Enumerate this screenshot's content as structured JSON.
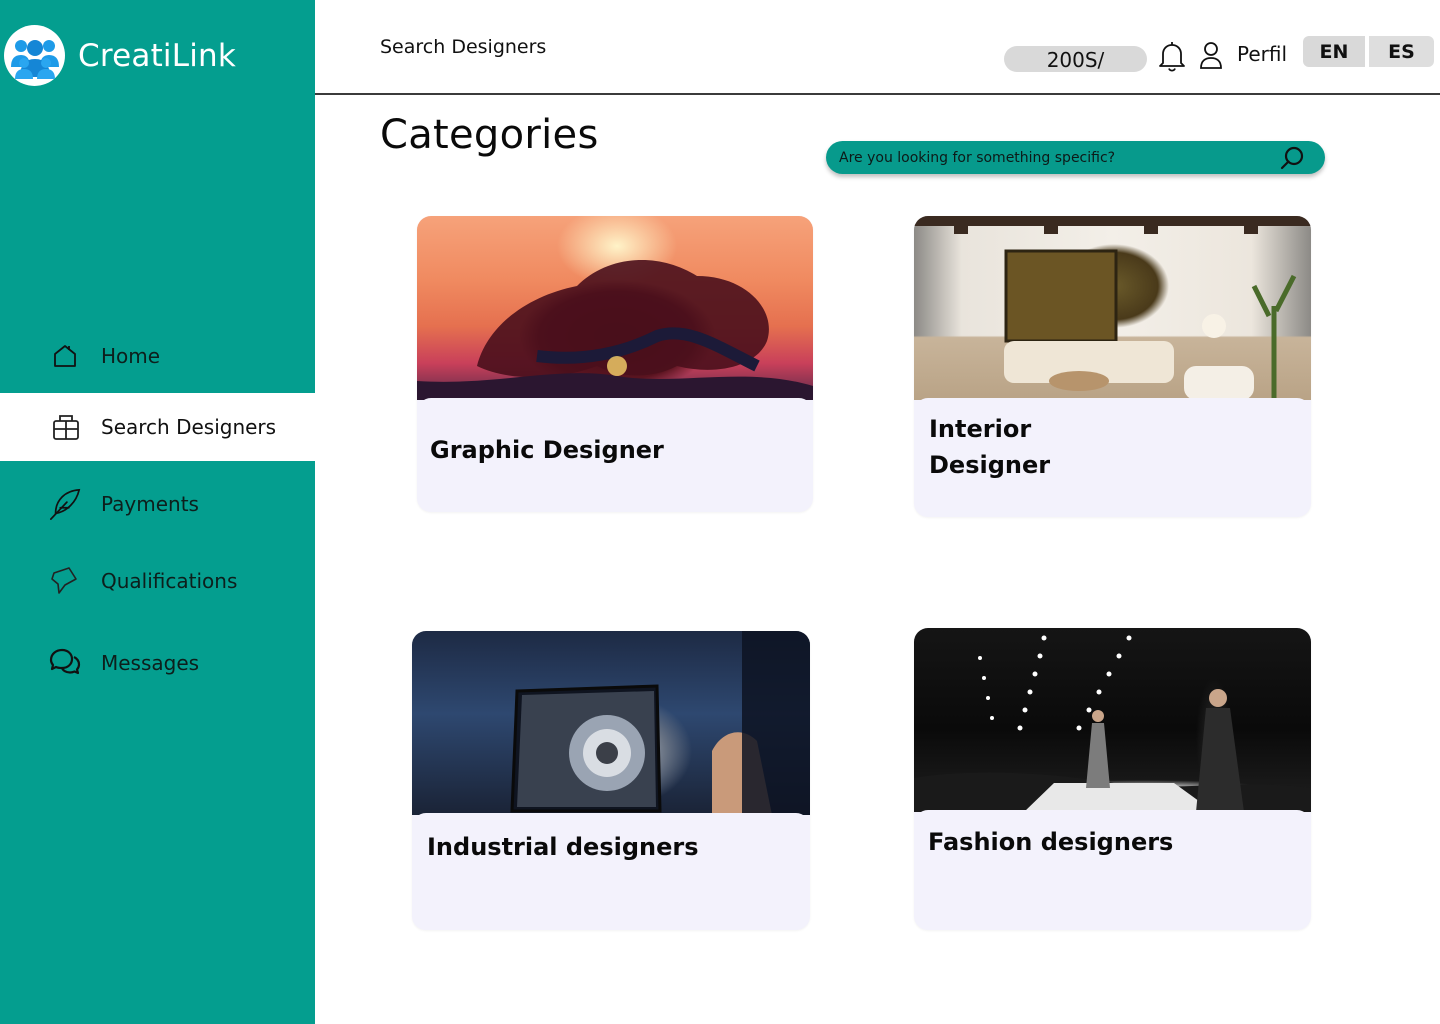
{
  "app": {
    "name": "CreatiLink"
  },
  "sidebar": {
    "items": [
      {
        "label": "Home",
        "icon": "home-icon",
        "active": false
      },
      {
        "label": "Search Designers",
        "icon": "grid-icon",
        "active": true
      },
      {
        "label": "Payments",
        "icon": "feather-icon",
        "active": false
      },
      {
        "label": "Qualifications",
        "icon": "star-icon",
        "active": false
      },
      {
        "label": "Messages",
        "icon": "chat-icon",
        "active": false
      }
    ]
  },
  "header": {
    "title": "Search Designers",
    "balance": "200S/",
    "profile_label": "Perfil",
    "languages": [
      "EN",
      "ES"
    ]
  },
  "main": {
    "title": "Categories",
    "search": {
      "placeholder": "Are you looking for something specific?"
    },
    "categories": [
      {
        "label": "Graphic Designer",
        "image": "graphic-design-artwork"
      },
      {
        "label": "Interior\nDesigner",
        "image": "interior-living-room"
      },
      {
        "label": "Industrial designers",
        "image": "industrial-3d-model"
      },
      {
        "label": "Fashion designers",
        "image": "fashion-runway"
      }
    ]
  },
  "colors": {
    "primary": "#049e8f",
    "search_bg": "#079a8c",
    "card_bg": "#f3f2fc",
    "pill_bg": "#d9d9d9"
  }
}
